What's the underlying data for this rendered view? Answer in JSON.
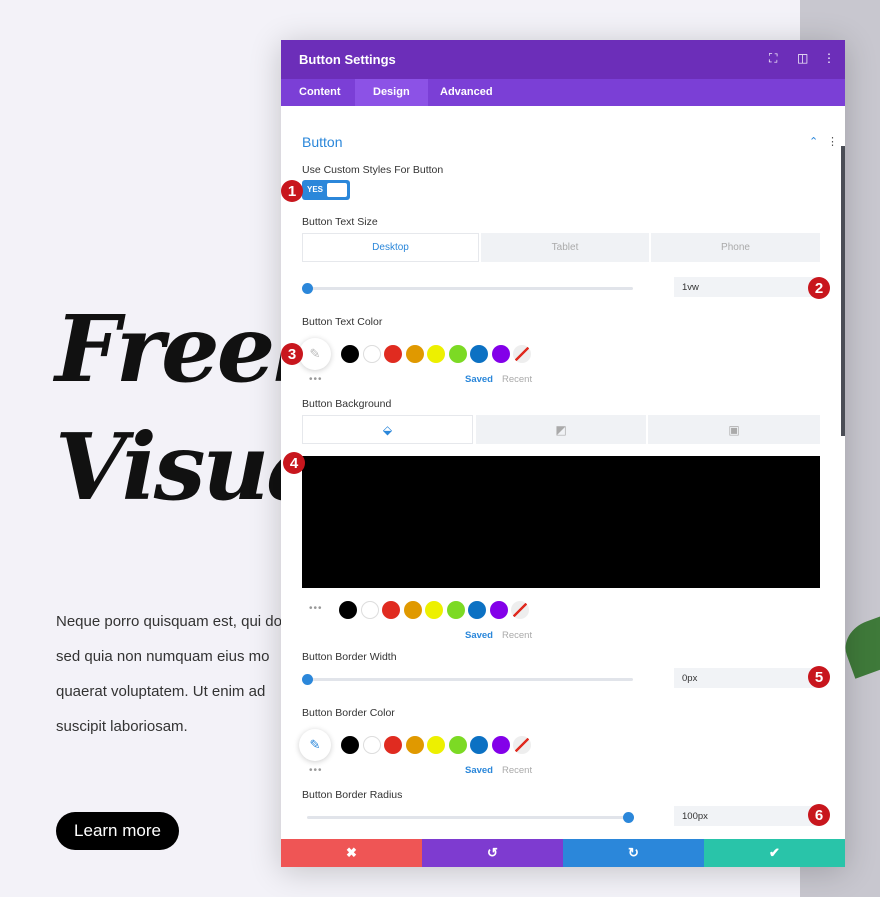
{
  "page": {
    "hero_lines": [
      "Freelan",
      "Visual"
    ],
    "paragraph": [
      "Neque porro quisquam est, qui do",
      "sed quia non numquam eius mo",
      "quaerat voluptatem. Ut enim ad",
      "suscipit laboriosam."
    ],
    "button_label": "Learn more"
  },
  "modal": {
    "title": "Button Settings",
    "tabs": [
      "Content",
      "Design",
      "Advanced"
    ],
    "active_tab": "Design",
    "section_title": "Button",
    "custom_styles": {
      "label": "Use Custom Styles For Button",
      "value": "YES"
    },
    "text_size": {
      "label": "Button Text Size",
      "devices": [
        "Desktop",
        "Tablet",
        "Phone"
      ],
      "value": "1vw",
      "slider_percent": 0
    },
    "text_color": {
      "label": "Button Text Color"
    },
    "background": {
      "label": "Button Background",
      "color": "#000000"
    },
    "border_width": {
      "label": "Button Border Width",
      "value": "0px",
      "slider_percent": 0
    },
    "border_color": {
      "label": "Button Border Color"
    },
    "border_radius": {
      "label": "Button Border Radius",
      "value": "100px",
      "slider_percent": 100
    },
    "saved_label": "Saved",
    "recent_label": "Recent",
    "swatches": [
      "#000000",
      "#ffffff",
      "#e02b20",
      "#e09900",
      "#edf000",
      "#7cda24",
      "#0c71c3",
      "#8300e9"
    ],
    "footer": {
      "cancel": "✖",
      "undo": "↺",
      "redo": "↻",
      "save": "✔"
    }
  },
  "badges": [
    "1",
    "2",
    "3",
    "4",
    "5",
    "6"
  ],
  "colors": {
    "header": "#6c2eb9",
    "tabs": "#7b3fd6",
    "accent": "#2b87da",
    "cancel": "#ef5555",
    "undo": "#7e3bd0",
    "redo": "#2b87da",
    "save": "#29c4a9"
  }
}
